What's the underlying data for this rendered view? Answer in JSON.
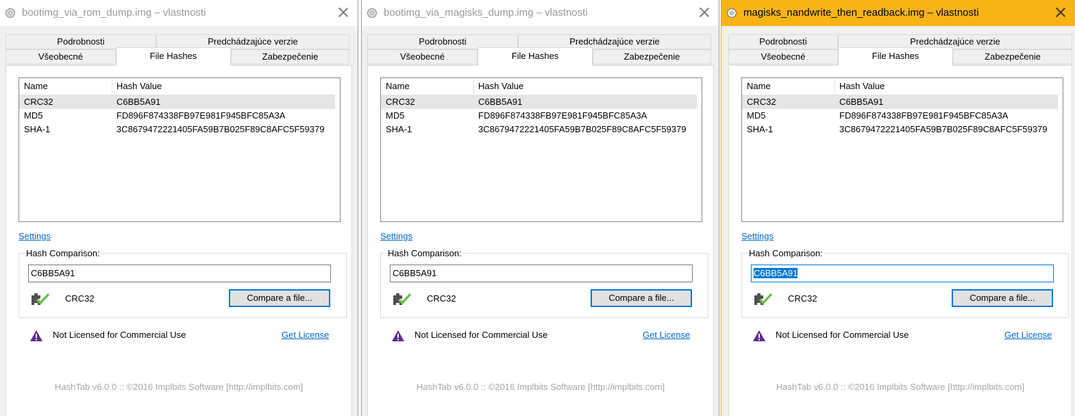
{
  "tabs": {
    "details": "Podrobnosti",
    "previous_versions": "Predchádzajúce verzie",
    "general": "Všeobecné",
    "file_hashes": "File Hashes",
    "security": "Zabezpečenie"
  },
  "hash_list": {
    "col_name": "Name",
    "col_value": "Hash Value",
    "rows": [
      {
        "name": "CRC32",
        "value": "C6BB5A91"
      },
      {
        "name": "MD5",
        "value": "FD896F874338FB97E981F945BFC85A3A"
      },
      {
        "name": "SHA-1",
        "value": "3C8679472221405FA59B7B025F89C8AFC5F59379"
      }
    ]
  },
  "settings_link": "Settings",
  "comparison": {
    "label": "Hash Comparison:",
    "algorithm": "CRC32",
    "compare_button": "Compare a file..."
  },
  "license": {
    "text": "Not Licensed for Commercial Use",
    "link": "Get License"
  },
  "footer": "HashTab v6.0.0 :: ©2016 Implbits Software [http://implbits.com]",
  "colors": {
    "active_titlebar": "#f8b415",
    "link": "#0066cc",
    "focus": "#0078d7",
    "check_green": "#6cc04a",
    "warning_purple": "#5b2d8e"
  },
  "windows": [
    {
      "title": "bootimg_via_rom_dump.img – vlastnosti",
      "input_value": "C6BB5A91"
    },
    {
      "title": "bootimg_via_magisks_dump.img – vlastnosti",
      "input_value": "C6BB5A91"
    },
    {
      "title": "magisks_nandwrite_then_readback.img – vlastnosti",
      "input_value": "C6BB5A91"
    }
  ]
}
